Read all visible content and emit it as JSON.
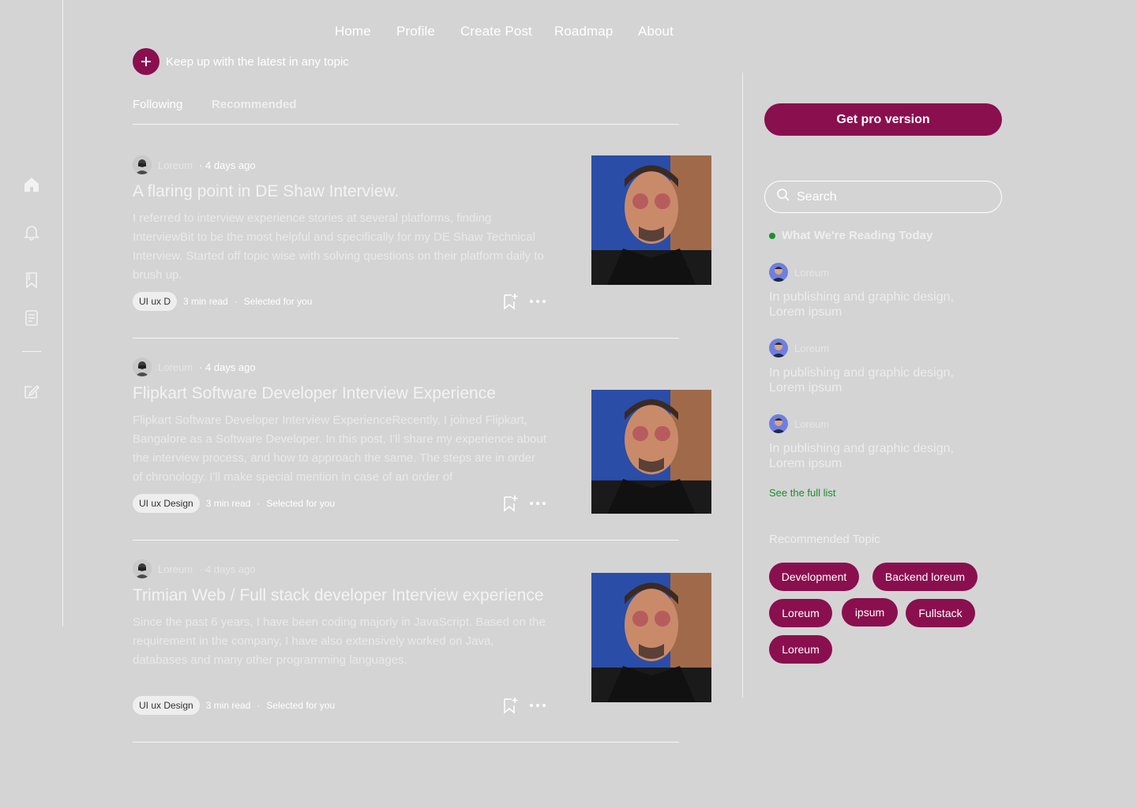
{
  "nav": {
    "items": [
      "Home",
      "Profile",
      "Create Post",
      "Roadmap",
      "About"
    ]
  },
  "sidebar": {
    "icons": [
      "home-icon",
      "bell-icon",
      "bookmark-icon",
      "document-icon",
      "edit-icon"
    ]
  },
  "topic": {
    "text": "Keep up with the latest in any topic"
  },
  "tabs": [
    "Following",
    "Recommended"
  ],
  "articles": [
    {
      "author": "Loreum",
      "posted": "· 4 days ago",
      "title": "A flaring point in DE Shaw Interview.",
      "body": "I referred to interview experience stories at several platforms, finding InterviewBit to be the most helpful and specifically for my DE Shaw Technical Interview. Started off topic wise with solving questions on their platform daily to brush up.",
      "tag": "UI ux D",
      "read_time": "3 min read",
      "dot": "·",
      "selected": "Selected for you"
    },
    {
      "author": "Loreum",
      "posted": "· 4 days ago",
      "title": "Flipkart Software Developer Interview Experience",
      "body": "Flipkart Software Developer Interview ExperienceRecently, I joined Flipkart, Bangalore as a Software Developer. In this post, I'll share my experience about the interview process, and how to approach the same. The steps are in order of chronology. I'll make special mention in case of an order of",
      "tag": "UI ux Design",
      "read_time": "3 min read",
      "dot": "·",
      "selected": "Selected for you"
    },
    {
      "author": "Loreum",
      "posted": "· 4 days ago",
      "title": "Trimian Web / Full stack developer Interview experience",
      "body": "Since the past 6 years, I have been coding majorly in JavaScript. Based on the requirement in the company, I have also extensively worked on Java, databases and many other programming languages.",
      "tag": "UI ux Design",
      "read_time": "3 min read",
      "dot": "·",
      "selected": "Selected for you"
    }
  ],
  "right": {
    "pro_button": "Get pro version",
    "search_placeholder": "Search",
    "reading_title": "What We're Reading Today",
    "reading_items": [
      {
        "author": "Loreum",
        "text": "In publishing and graphic design, Lorem ipsum"
      },
      {
        "author": "Loreum",
        "text": "In publishing and graphic design, Lorem ipsum"
      },
      {
        "author": "Loreum",
        "text": "In publishing and graphic design, Lorem ipsum"
      }
    ],
    "see_full": "See the full list",
    "recommended_title": "Recommended Topic",
    "topics": [
      "Development",
      "Backend loreum",
      "Loreum",
      "ipsum",
      "Fullstack",
      "Loreum"
    ]
  },
  "colors": {
    "background": "#d4d4d4",
    "accent": "#8a0f4f",
    "green": "#1a8f2a"
  }
}
